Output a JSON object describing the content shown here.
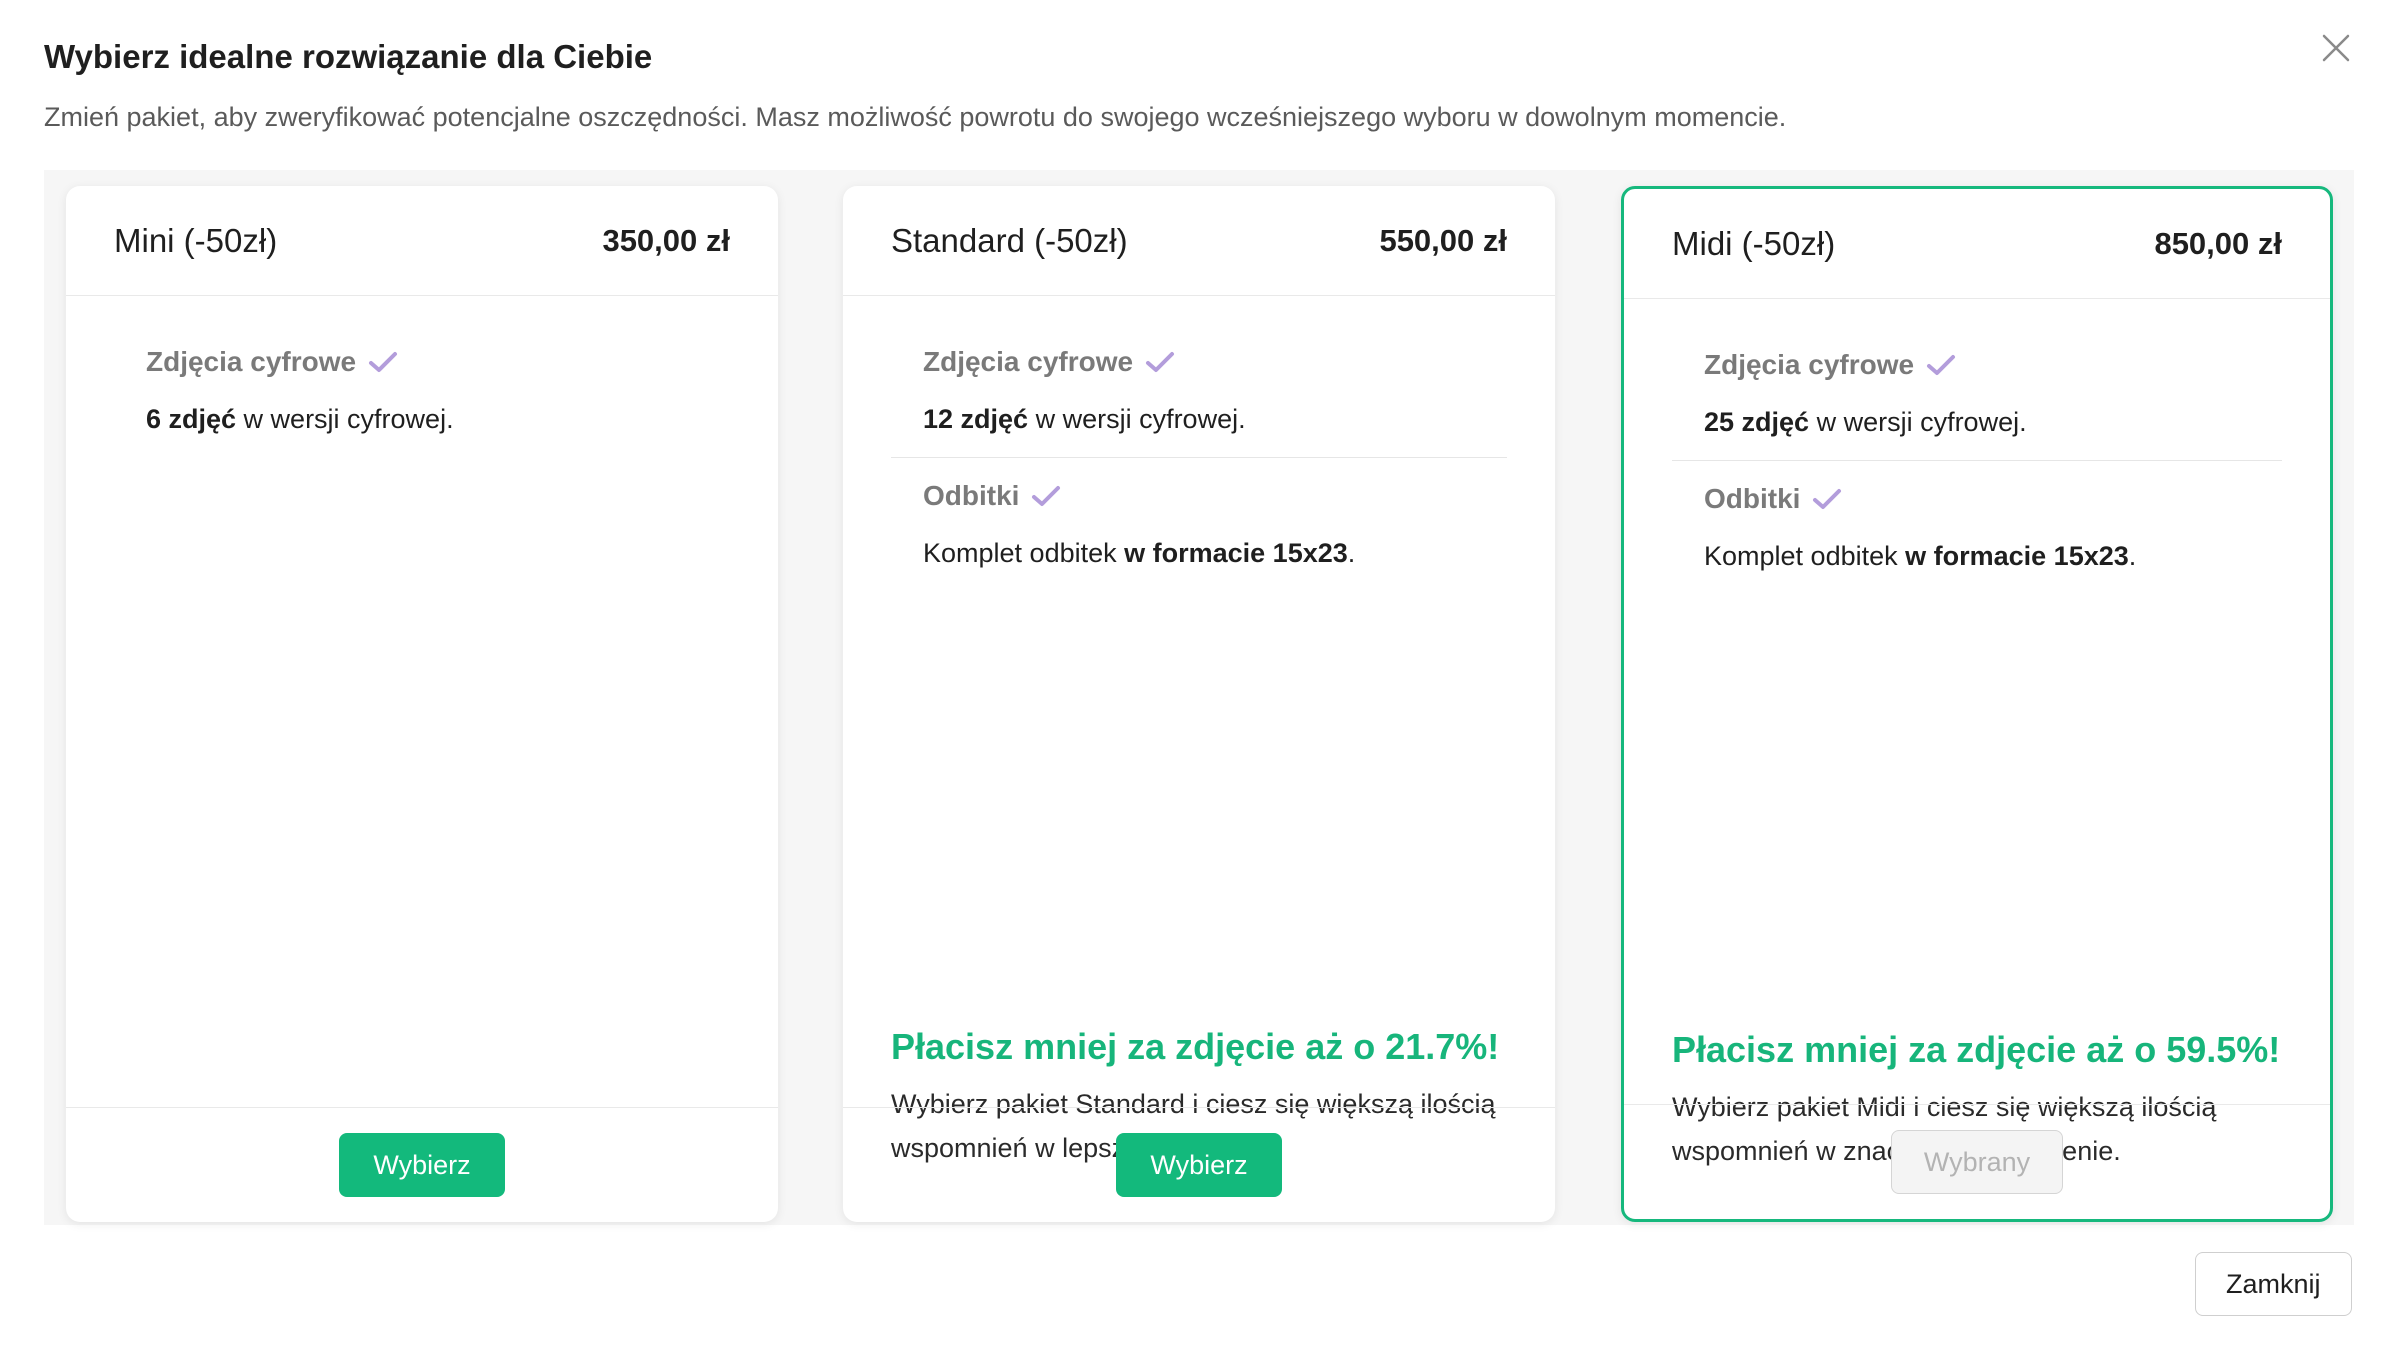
{
  "modal": {
    "title": "Wybierz idealne rozwiązanie dla Ciebie",
    "subtitle": "Zmień pakiet, aby zweryfikować potencjalne oszczędności. Masz możliwość powrotu do swojego wcześniejszego wyboru w dowolnym momencie.",
    "close_label": "Zamknij"
  },
  "packages": [
    {
      "name": "Mini (-50zł)",
      "price": "350,00 zł",
      "features": {
        "digital": {
          "title": "Zdjęcia cyfrowe",
          "count": "6 zdjęć",
          "rest": " w wersji cyfrowej."
        }
      },
      "button": "Wybierz"
    },
    {
      "name": "Standard (-50zł)",
      "price": "550,00 zł",
      "features": {
        "digital": {
          "title": "Zdjęcia cyfrowe",
          "count": "12 zdjęć",
          "rest": " w wersji cyfrowej."
        },
        "prints": {
          "title": "Odbitki",
          "prefix": "Komplet odbitek ",
          "bold": "w formacie 15x23",
          "suffix": "."
        }
      },
      "promo": {
        "title": "Płacisz mniej za zdjęcie aż o 21.7%!",
        "line1": "Wybierz pakiet Standard i ciesz się większą ilością",
        "line2": "wspomnień w lepszej cenie."
      },
      "button": "Wybierz"
    },
    {
      "name": "Midi (-50zł)",
      "price": "850,00 zł",
      "features": {
        "digital": {
          "title": "Zdjęcia cyfrowe",
          "count": "25 zdjęć",
          "rest": " w wersji cyfrowej."
        },
        "prints": {
          "title": "Odbitki",
          "prefix": "Komplet odbitek ",
          "bold": "w formacie 15x23",
          "suffix": "."
        }
      },
      "promo": {
        "title": "Płacisz mniej za zdjęcie aż o 59.5%!",
        "line1": "Wybierz pakiet Midi i ciesz się większą ilością",
        "line2": "wspomnień w znacznie lepszej cenie."
      },
      "button": "Wybrany",
      "selected": true
    }
  ],
  "icons": {
    "close": "close-icon",
    "check": "check-icon"
  },
  "colors": {
    "accent": "#13b97c",
    "check": "#b39ddb"
  }
}
